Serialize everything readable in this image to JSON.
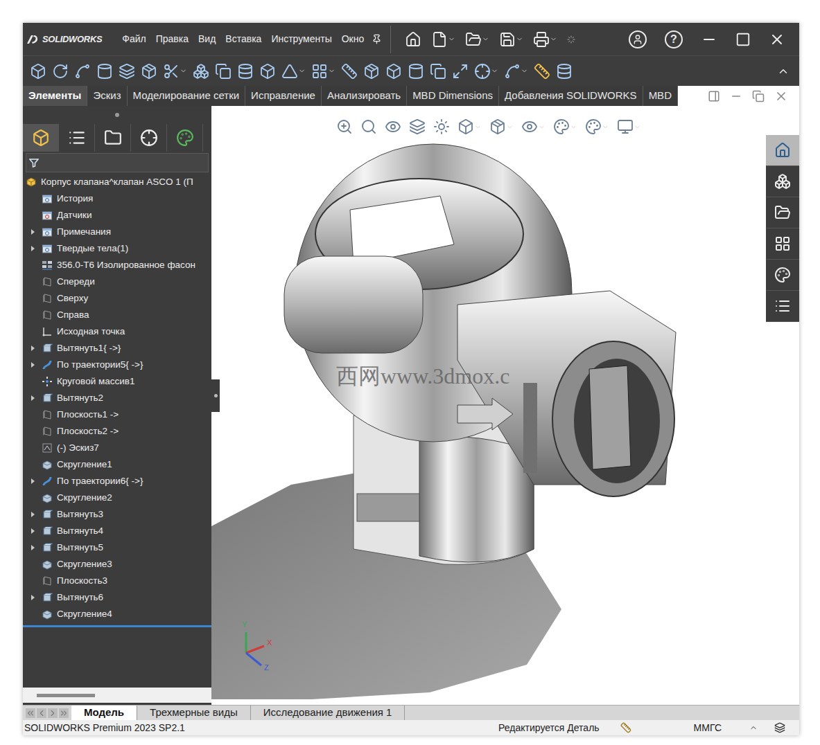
{
  "window": {
    "logo": "SOLIDWORKS",
    "help": "?"
  },
  "menu": [
    "Файл",
    "Правка",
    "Вид",
    "Вставка",
    "Инструменты",
    "Окно"
  ],
  "command_tabs": [
    {
      "label": "Элементы",
      "selected": true
    },
    {
      "label": "Эскиз",
      "selected": false
    },
    {
      "label": "Моделирование сетки",
      "selected": false
    },
    {
      "label": "Исправление",
      "selected": false
    },
    {
      "label": "Анализировать",
      "selected": false
    },
    {
      "label": "MBD Dimensions",
      "selected": false
    },
    {
      "label": "Добавления SOLIDWORKS",
      "selected": false
    },
    {
      "label": "MBD",
      "selected": false
    }
  ],
  "feature_tree": {
    "root": "Корпус клапана^клапан ASCO 1 (П",
    "items": [
      {
        "label": "История",
        "kind": "history",
        "expandable": false
      },
      {
        "label": "Датчики",
        "kind": "sensor",
        "expandable": false
      },
      {
        "label": "Примечания",
        "kind": "annotation",
        "expandable": true
      },
      {
        "label": "Твердые тела(1)",
        "kind": "bodies",
        "expandable": true
      },
      {
        "label": "356.0-T6 Изолированное фасон",
        "kind": "material",
        "expandable": false
      },
      {
        "label": "Спереди",
        "kind": "plane",
        "expandable": false
      },
      {
        "label": "Сверху",
        "kind": "plane",
        "expandable": false
      },
      {
        "label": "Справа",
        "kind": "plane",
        "expandable": false
      },
      {
        "label": "Исходная точка",
        "kind": "origin",
        "expandable": false
      },
      {
        "label": "Вытянуть1{ ->}",
        "kind": "extrude",
        "expandable": true
      },
      {
        "label": "По траектории5{ ->}",
        "kind": "sweep",
        "expandable": true
      },
      {
        "label": "Круговой массив1",
        "kind": "pattern",
        "expandable": false
      },
      {
        "label": "Вытянуть2",
        "kind": "extrude",
        "expandable": true
      },
      {
        "label": "Плоскость1 ->",
        "kind": "plane",
        "expandable": false
      },
      {
        "label": "Плоскость2 ->",
        "kind": "plane",
        "expandable": false
      },
      {
        "label": "(-) Эскиз7",
        "kind": "sketch",
        "expandable": false
      },
      {
        "label": "Скругление1",
        "kind": "fillet",
        "expandable": false
      },
      {
        "label": "По траектории6{ ->}",
        "kind": "sweep",
        "expandable": true
      },
      {
        "label": "Скругление2",
        "kind": "fillet",
        "expandable": false
      },
      {
        "label": "Вытянуть3",
        "kind": "extrude",
        "expandable": true
      },
      {
        "label": "Вытянуть4",
        "kind": "extrude",
        "expandable": true
      },
      {
        "label": "Вытянуть5",
        "kind": "extrude",
        "expandable": true
      },
      {
        "label": "Скругление3",
        "kind": "fillet",
        "expandable": false
      },
      {
        "label": "Плоскость3",
        "kind": "plane",
        "expandable": false
      },
      {
        "label": "Вытянуть6",
        "kind": "extrude",
        "expandable": true
      },
      {
        "label": "Скругление4",
        "kind": "fillet",
        "expandable": false
      }
    ]
  },
  "viewport": {
    "watermark": "西网www.3dmox.c",
    "triad": {
      "y": "Y",
      "x": "X",
      "z": "Z"
    }
  },
  "bottom_tabs": [
    {
      "label": "Модель",
      "selected": true
    },
    {
      "label": "Трехмерные виды",
      "selected": false
    },
    {
      "label": "Исследование движения 1",
      "selected": false
    }
  ],
  "status_bar": {
    "product": "SOLIDWORKS Premium 2023 SP2.1",
    "mode": "Редактируется Деталь",
    "units": "ММГС"
  }
}
